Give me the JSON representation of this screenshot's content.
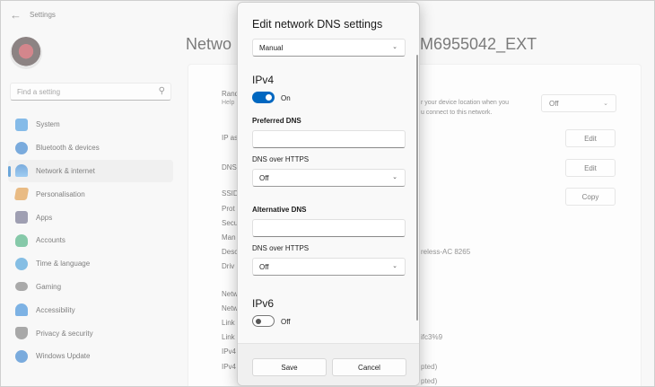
{
  "app": {
    "title": "Settings"
  },
  "search": {
    "placeholder": "Find a setting"
  },
  "sidebar": {
    "items": [
      {
        "label": "System",
        "icon": "monitor-icon",
        "color": "#2e8bd8"
      },
      {
        "label": "Bluetooth & devices",
        "icon": "bluetooth-icon",
        "color": "#1b6fc4"
      },
      {
        "label": "Network & internet",
        "icon": "wifi-icon",
        "color": "#1b6fc4",
        "active": true
      },
      {
        "label": "Personalisation",
        "icon": "brush-icon",
        "color": "#d98a2c"
      },
      {
        "label": "Apps",
        "icon": "apps-icon",
        "color": "#5a5a7a"
      },
      {
        "label": "Accounts",
        "icon": "person-icon",
        "color": "#2fa36b"
      },
      {
        "label": "Time & language",
        "icon": "globe-icon",
        "color": "#2d8fd0"
      },
      {
        "label": "Gaming",
        "icon": "gamepad-icon",
        "color": "#6b6b6b"
      },
      {
        "label": "Accessibility",
        "icon": "accessibility-icon",
        "color": "#1f7bd0"
      },
      {
        "label": "Privacy & security",
        "icon": "shield-icon",
        "color": "#6a6a6a"
      },
      {
        "label": "Windows Update",
        "icon": "update-icon",
        "color": "#1b6fc4"
      }
    ]
  },
  "page": {
    "title_left": "Netwo",
    "title_right": "M6955042_EXT",
    "labels": [
      "Rand",
      "Help",
      "IP as",
      "DNS",
      "SSID",
      "Prot",
      "Secu",
      "Man",
      "Desc",
      "Driv",
      "Netw",
      "Netw",
      "Link",
      "Link",
      "IPv4",
      "IPv4"
    ],
    "random_desc_1": "r your device location when you",
    "random_desc_2": "u connect to this network.",
    "random_value": "Off",
    "ip_edit": "Edit",
    "dns_edit": "Edit",
    "copy": "Copy",
    "adapter_text": "reless-AC 8265",
    "link_text": "ifc3%9",
    "ipv4_a": "pted)",
    "ipv4_b": "pted)"
  },
  "dialog": {
    "title": "Edit network DNS settings",
    "mode": "Manual",
    "ipv4": {
      "heading": "IPv4",
      "toggle_state": "On",
      "preferred_label": "Preferred DNS",
      "preferred_value": "",
      "doh_label_1": "DNS over HTTPS",
      "doh_value_1": "Off",
      "alternate_label": "Alternative DNS",
      "alternate_value": "",
      "doh_label_2": "DNS over HTTPS",
      "doh_value_2": "Off"
    },
    "ipv6": {
      "heading": "IPv6",
      "toggle_state": "Off"
    },
    "save": "Save",
    "cancel": "Cancel"
  },
  "colors": {
    "accent": "#0067c0"
  }
}
